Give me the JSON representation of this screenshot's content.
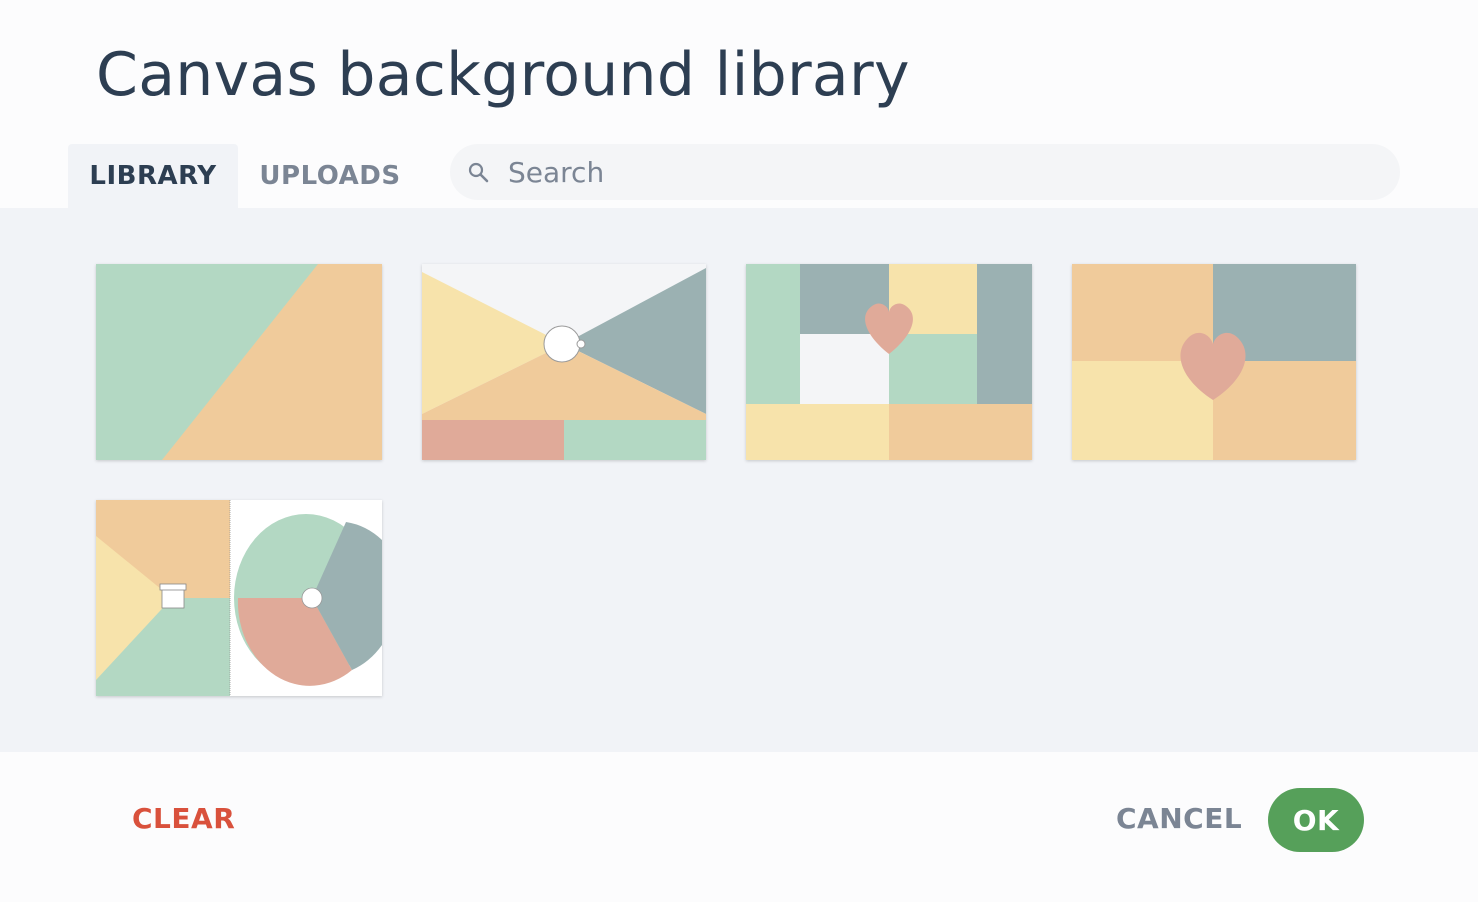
{
  "dialog": {
    "title": "Canvas background library"
  },
  "tabs": [
    {
      "label": "LIBRARY",
      "active": true
    },
    {
      "label": "UPLOADS",
      "active": false
    }
  ],
  "search": {
    "placeholder": "Search",
    "value": ""
  },
  "backgrounds": [
    {
      "name": "diagonal-split"
    },
    {
      "name": "bowtie-triangles"
    },
    {
      "name": "heart-grid-blocks"
    },
    {
      "name": "heart-quadrants"
    },
    {
      "name": "gift-and-pie-wheel"
    }
  ],
  "colors": {
    "mint": "#b3d8c3",
    "peach": "#f0cb9b",
    "yellow": "#f7e3ab",
    "slate": "#9bb1b2",
    "salmon": "#e0aa99",
    "ok_green": "#56a05a",
    "clear_red": "#d9513c"
  },
  "footer": {
    "clear_label": "CLEAR",
    "cancel_label": "CANCEL",
    "ok_label": "OK"
  }
}
